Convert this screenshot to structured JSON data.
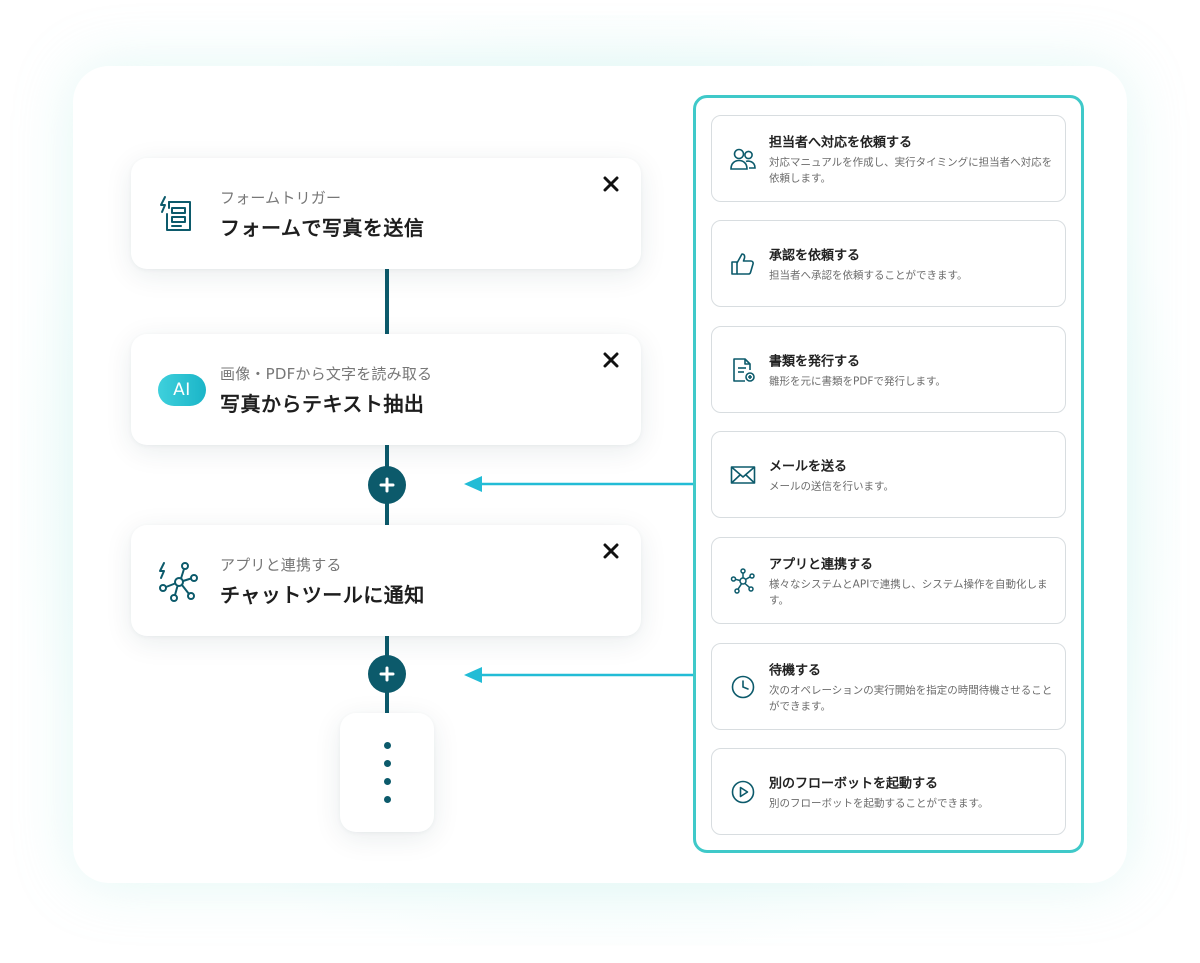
{
  "flow": {
    "steps": [
      {
        "subtitle": "フォームトリガー",
        "title": "フォームで写真を送信",
        "icon": "form-trigger-icon"
      },
      {
        "subtitle": "画像・PDFから文字を読み取る",
        "title": "写真からテキスト抽出",
        "icon": "ai-badge",
        "badge_text": "AI"
      },
      {
        "subtitle": "アプリと連携する",
        "title": "チャットツールに通知",
        "icon": "app-integration-icon"
      }
    ],
    "close_icon": "close-icon",
    "add_icon": "plus-icon",
    "more_icon": "vertical-dots-icon"
  },
  "menu": {
    "items": [
      {
        "title": "担当者へ対応を依頼する",
        "desc": "対応マニュアルを作成し、実行タイミングに担当者へ対応を依頼します。",
        "icon": "people-icon"
      },
      {
        "title": "承認を依頼する",
        "desc": "担当者へ承認を依頼することができます。",
        "icon": "thumbs-up-icon"
      },
      {
        "title": "書類を発行する",
        "desc": "雛形を元に書類をPDFで発行します。",
        "icon": "document-add-icon"
      },
      {
        "title": "メールを送る",
        "desc": "メールの送信を行います。",
        "icon": "mail-icon"
      },
      {
        "title": "アプリと連携する",
        "desc": "様々なシステムとAPIで連携し、システム操作を自動化します。",
        "icon": "network-icon"
      },
      {
        "title": "待機する",
        "desc": "次のオペレーションの実行開始を指定の時間待機させることができます。",
        "icon": "clock-icon"
      },
      {
        "title": "別のフローボットを起動する",
        "desc": "別のフローボットを起動することができます。",
        "icon": "play-circle-icon"
      }
    ]
  },
  "colors": {
    "primary": "#0c5a6b",
    "accent": "#3fc9c9",
    "arrow": "#22bcd6",
    "ai_gradient": [
      "#3ed0dc",
      "#1bb5c8"
    ]
  }
}
